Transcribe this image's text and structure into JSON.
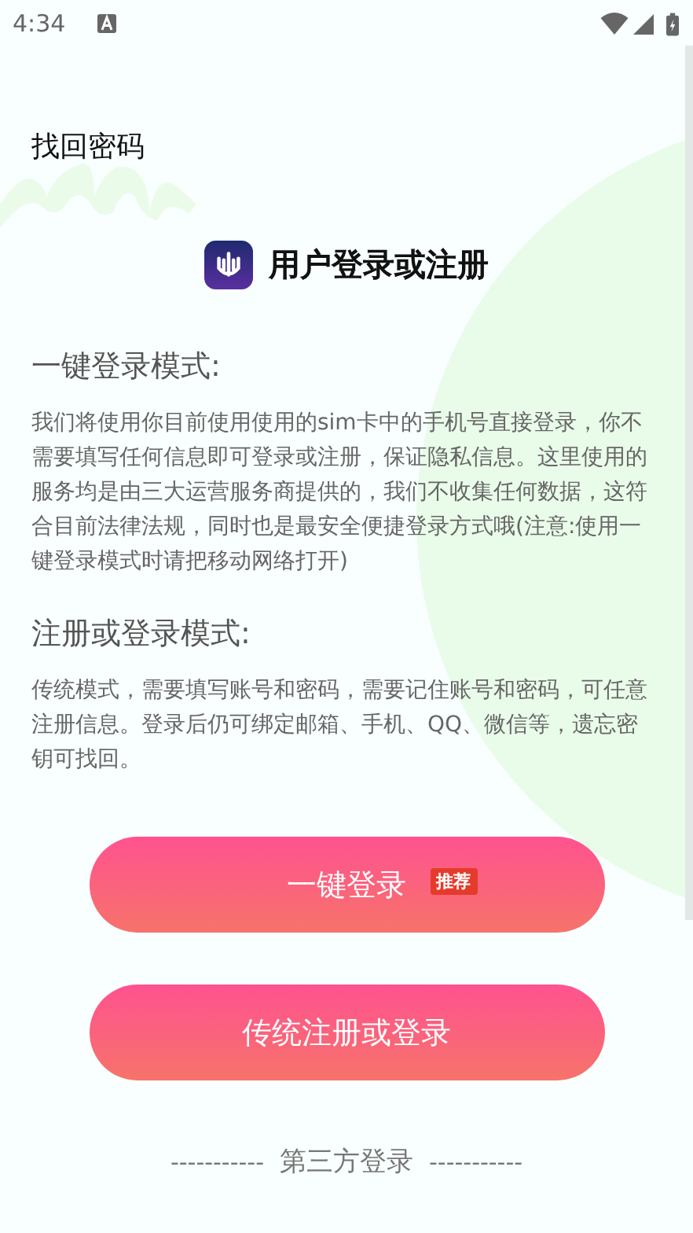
{
  "status_bar": {
    "time": "4:34"
  },
  "header": {
    "link": "找回密码"
  },
  "brand": {
    "title": "用户登录或注册"
  },
  "sections": [
    {
      "heading": "一键登录模式:",
      "body": "我们将使用你目前使用使用的sim卡中的手机号直接登录，你不需要填写任何信息即可登录或注册，保证隐私信息。这里使用的服务均是由三大运营服务商提供的，我们不收集任何数据，这符合目前法律法规，同时也是最安全便捷登录方式哦(注意:使用一键登录模式时请把移动网络打开)"
    },
    {
      "heading": "注册或登录模式:",
      "body": "传统模式，需要填写账号和密码，需要记住账号和密码，可任意注册信息。登录后仍可绑定邮箱、手机、QQ、微信等，遗忘密钥可找回。"
    }
  ],
  "buttons": [
    {
      "label": "一键登录",
      "badge": "推荐"
    },
    {
      "label": "传统注册或登录"
    }
  ],
  "divider": {
    "left": "-----------",
    "label": "第三方登录",
    "right": "-----------"
  }
}
